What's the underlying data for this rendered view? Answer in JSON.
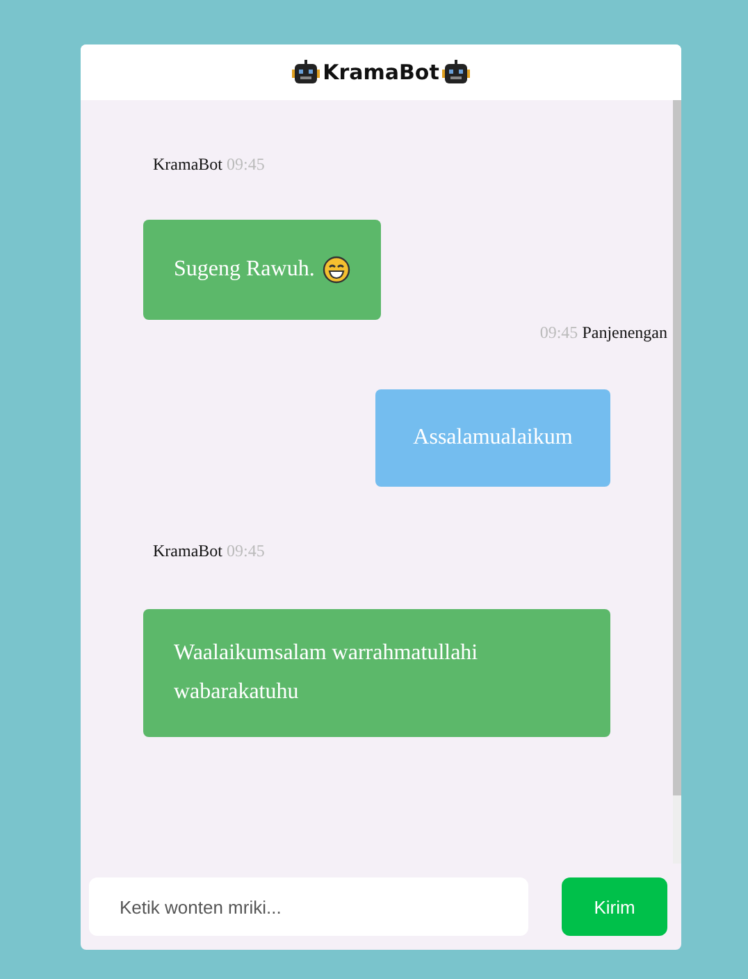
{
  "header": {
    "title": "KramaBot"
  },
  "messages": [
    {
      "kind": "bot",
      "sender": "KramaBot",
      "time": "09:45",
      "text": "Sugeng Rawuh.",
      "emoji": true
    },
    {
      "kind": "user",
      "sender": "Panjenengan",
      "time": "09:45",
      "text": "Assalamualaikum",
      "emoji": false
    },
    {
      "kind": "bot",
      "sender": "KramaBot",
      "time": "09:45",
      "text": "Waalaikumsalam warrahmatullahi wabarakatuhu",
      "emoji": false
    }
  ],
  "input": {
    "placeholder": "Ketik wonten mriki..."
  },
  "send_button": {
    "label": "Kirim"
  }
}
